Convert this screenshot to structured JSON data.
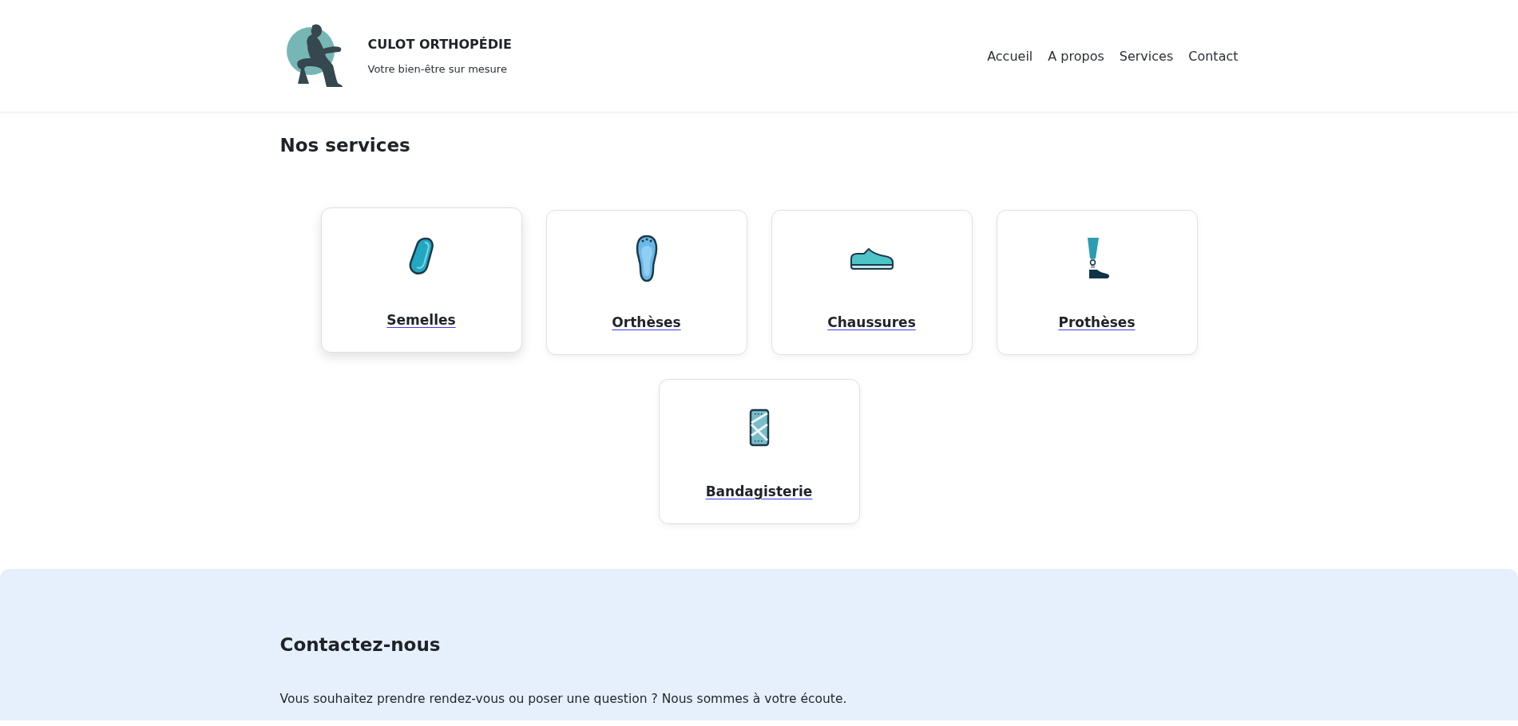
{
  "header": {
    "brand": "CULOT ORTHOPÉDIE",
    "tagline": "Votre bien-être sur mesure",
    "nav": [
      "Accueil",
      "A propos",
      "Services",
      "Contact"
    ]
  },
  "services": {
    "title": "Nos services",
    "cards": [
      {
        "kind": "insole",
        "label": "Semelles",
        "hovered": true
      },
      {
        "kind": "orthosis",
        "label": "Orthèses",
        "hovered": false
      },
      {
        "kind": "shoe",
        "label": "Chaussures",
        "hovered": false
      },
      {
        "kind": "prosthesis",
        "label": "Prothèses",
        "hovered": false
      },
      {
        "kind": "bandage",
        "label": "Bandagisterie",
        "hovered": false
      }
    ]
  },
  "contact": {
    "title": "Contactez-nous",
    "text": "Vous souhaitez prendre rendez-vous ou poser une question ? Nous sommes à votre écoute."
  }
}
